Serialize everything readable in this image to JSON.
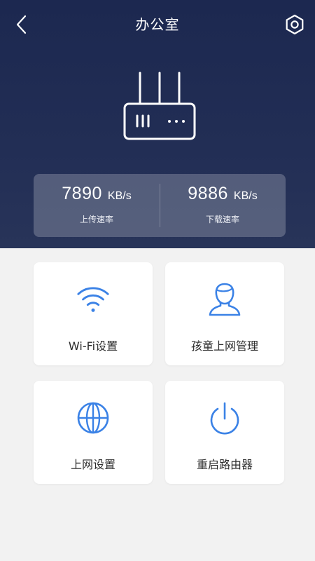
{
  "header": {
    "title": "办公室",
    "back_icon": "chevron-left-icon",
    "settings_icon": "hexagon-settings-icon"
  },
  "device": {
    "icon": "router-icon"
  },
  "stats": {
    "upload": {
      "value": "7890",
      "unit": "KB/s",
      "label": "上传速率"
    },
    "download": {
      "value": "9886",
      "unit": "KB/s",
      "label": "下载速率"
    }
  },
  "menu": {
    "wifi": {
      "label": "Wi-Fi设置",
      "icon": "wifi-icon"
    },
    "child": {
      "label": "孩童上网管理",
      "icon": "person-icon"
    },
    "network": {
      "label": "上网设置",
      "icon": "globe-icon"
    },
    "reboot": {
      "label": "重启路由器",
      "icon": "power-icon"
    }
  },
  "colors": {
    "header_bg": "#1f2b52",
    "accent_blue": "#3b82e6",
    "page_bg": "#f2f2f2"
  }
}
